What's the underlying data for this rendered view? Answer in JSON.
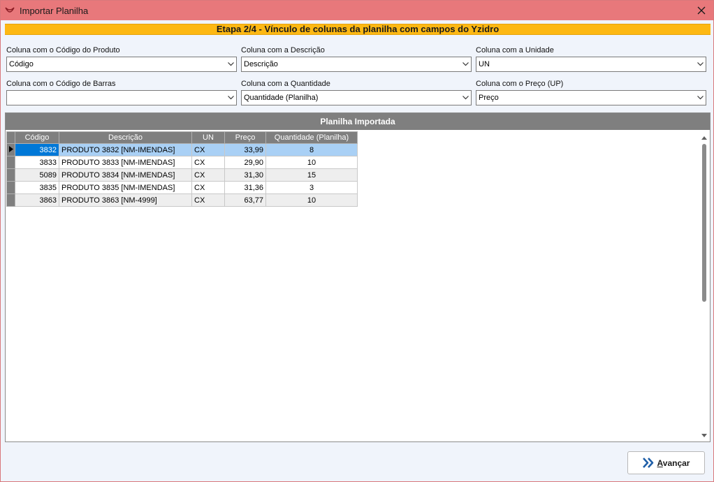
{
  "window": {
    "title": "Importar Planilha"
  },
  "stage": {
    "title": "Etapa 2/4 - Vínculo de colunas da planilha com campos do Yzidro"
  },
  "fields": {
    "codigo_produto": {
      "label": "Coluna com o Código do Produto",
      "value": "Código"
    },
    "descricao": {
      "label": "Coluna com a Descrição",
      "value": "Descrição"
    },
    "unidade": {
      "label": "Coluna com a Unidade",
      "value": "UN"
    },
    "codigo_barras": {
      "label": "Coluna com o Código de Barras",
      "value": ""
    },
    "quantidade": {
      "label": "Coluna com a Quantidade",
      "value": "Quantidade (Planilha)"
    },
    "preco": {
      "label": "Coluna com o Preço (UP)",
      "value": "Preço"
    }
  },
  "grid": {
    "title": "Planilha Importada",
    "columns": [
      "Código",
      "Descrição",
      "UN",
      "Preço",
      "Quantidade (Planilha)"
    ],
    "rows": [
      [
        "3832",
        "PRODUTO 3832 [NM-IMENDAS]",
        "CX",
        "33,99",
        "8"
      ],
      [
        "3833",
        "PRODUTO 3833 [NM-IMENDAS]",
        "CX",
        "29,90",
        "10"
      ],
      [
        "5089",
        "PRODUTO 3834 [NM-IMENDAS]",
        "CX",
        "31,30",
        "15"
      ],
      [
        "3835",
        "PRODUTO 3835 [NM-IMENDAS]",
        "CX",
        "31,36",
        "3"
      ],
      [
        "3863",
        "PRODUTO 3863 [NM-4999]",
        "CX",
        "63,77",
        "10"
      ]
    ]
  },
  "footer": {
    "next_label_prefix": "A",
    "next_label_rest": "vançar"
  },
  "colors": {
    "titlebar": "#e8787b",
    "stage": "#fdb813",
    "selection": "#0078d7",
    "header": "#7f7f7f"
  }
}
